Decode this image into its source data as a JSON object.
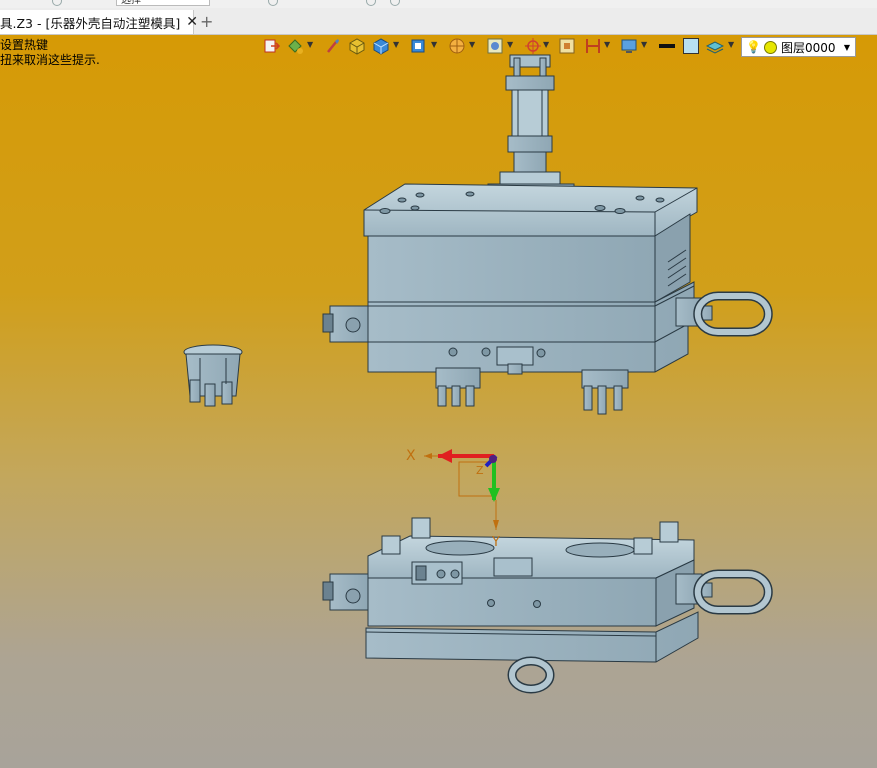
{
  "document_tab": {
    "title": "具.Z3 - [乐器外壳自动注塑模具]",
    "close_symbol": "✕",
    "add_symbol": "+"
  },
  "top_combo": {
    "value": "选择"
  },
  "hint": {
    "line1": "设置热键",
    "line2": "扭来取消这些提示."
  },
  "layer_selector": {
    "value": "图层0000"
  },
  "axes": {
    "x_label": "X",
    "y_label": "Y",
    "z_label": "Z"
  },
  "colors": {
    "mold_fill": "#a9c0cc",
    "mold_stroke": "#2a3a44",
    "background_top": "#d69a06",
    "background_bottom": "#a8a39a",
    "axis_x": "#e02020",
    "axis_y": "#20c020",
    "axis_z": "#2020c0"
  },
  "toolbar_icons": [
    "exit-icon",
    "paint-bucket-icon",
    "brush-icon",
    "shaded-cube-icon",
    "blue-cube-icon",
    "render-cube-icon",
    "sphere-icon",
    "view-frame-icon",
    "crosshair-icon",
    "fit-view-icon",
    "section-icon",
    "monitor-icon",
    "line-weight-icon",
    "color-swatch-icon",
    "layer-stack-icon"
  ]
}
